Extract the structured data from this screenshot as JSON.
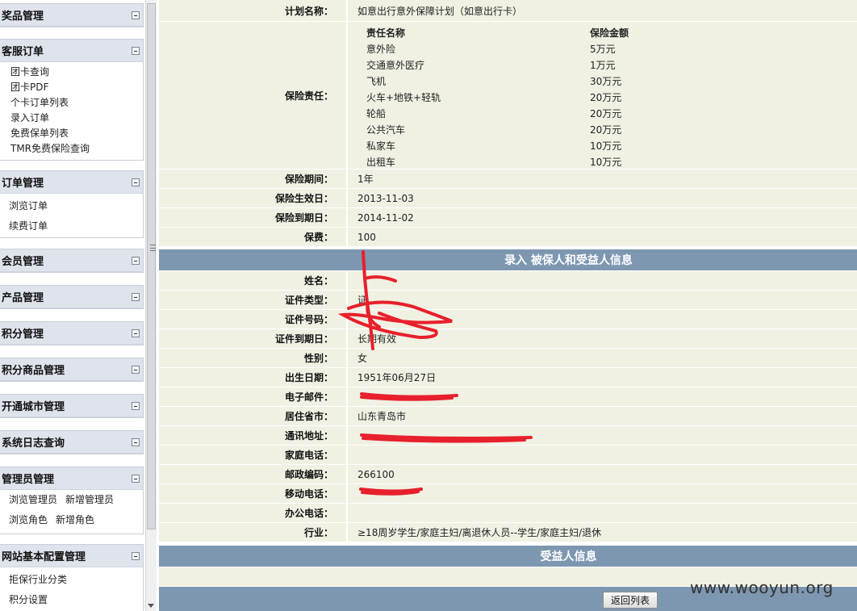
{
  "sidebar": {
    "sections": [
      {
        "title": "奖品管理",
        "items": []
      },
      {
        "title": "客服订单",
        "items": [
          "团卡查询",
          "团卡PDF",
          "个卡订单列表",
          "录入订单",
          "免费保单列表",
          "TMR免费保险查询"
        ]
      },
      {
        "title": "订单管理",
        "items": [
          "浏览订单",
          "续费订单"
        ]
      },
      {
        "title": "会员管理",
        "items": []
      },
      {
        "title": "产品管理",
        "items": []
      },
      {
        "title": "积分管理",
        "items": []
      },
      {
        "title": "积分商品管理",
        "items": []
      },
      {
        "title": "开通城市管理",
        "items": []
      },
      {
        "title": "系统日志查询",
        "items": []
      },
      {
        "title": "管理员管理",
        "items": [
          "浏览管理员",
          "新增管理员",
          "浏览角色",
          "新增角色"
        ]
      },
      {
        "title": "网站基本配置管理",
        "items": [
          "拒保行业分类",
          "积分设置"
        ]
      }
    ]
  },
  "plan": {
    "name_label": "计划名称：",
    "name_value": "如意出行意外保障计划（如意出行卡）",
    "coverage_label": "保险责任：",
    "coverage_header": [
      "责任名称",
      "保险金额"
    ],
    "coverage": [
      [
        "意外险",
        "5万元"
      ],
      [
        "交通意外医疗",
        "1万元"
      ],
      [
        "飞机",
        "30万元"
      ],
      [
        "火车+地铁+轻轨",
        "20万元"
      ],
      [
        "轮船",
        "20万元"
      ],
      [
        "公共汽车",
        "20万元"
      ],
      [
        "私家车",
        "10万元"
      ],
      [
        "出租车",
        "10万元"
      ]
    ],
    "period_label": "保险期间：",
    "period_value": "1年",
    "start_label": "保险生效日：",
    "start_value": "2013-11-03",
    "end_label": "保险到期日：",
    "end_value": "2014-11-02",
    "premium_label": "保费：",
    "premium_value": "100"
  },
  "insured": {
    "band_title": "录入 被保人和受益人信息",
    "fields": [
      {
        "label": "姓名：",
        "value": ""
      },
      {
        "label": "证件类型：",
        "value": "证"
      },
      {
        "label": "证件号码：",
        "value": ""
      },
      {
        "label": "证件到期日：",
        "value": "长期有效"
      },
      {
        "label": "性别：",
        "value": "女"
      },
      {
        "label": "出生日期：",
        "value": "1951年06月27日"
      },
      {
        "label": "电子邮件：",
        "value": ""
      },
      {
        "label": "居住省市：",
        "value": "山东青岛市"
      },
      {
        "label": "通讯地址：",
        "value": ""
      },
      {
        "label": "家庭电话：",
        "value": ""
      },
      {
        "label": "邮政编码：",
        "value": "266100"
      },
      {
        "label": "移动电话：",
        "value": ""
      },
      {
        "label": "办公电话：",
        "value": ""
      },
      {
        "label": "行业：",
        "value": "≥18周岁学生/家庭主妇/离退休人员--学生/家庭主妇/退休"
      }
    ]
  },
  "beneficiary": {
    "band_title": "受益人信息"
  },
  "footer": {
    "back_button": "返回列表"
  },
  "watermark": "www.wooyun.org",
  "colors": {
    "band": "#7d97b1",
    "row_bg": "#f0f1e3",
    "scribble": "#e8202c",
    "sidebar_head": "#dfe3ec"
  }
}
